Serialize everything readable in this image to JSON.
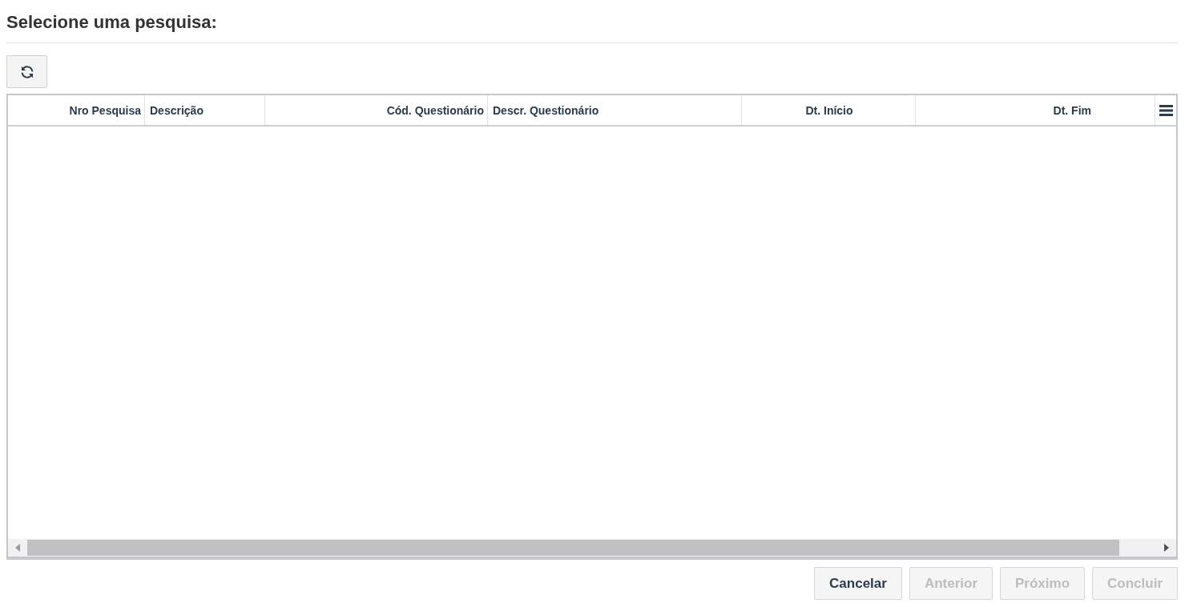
{
  "title": "Selecione uma pesquisa:",
  "toolbar": {
    "refresh_button": {
      "disabled": false
    }
  },
  "table": {
    "columns": [
      {
        "label": "Nro Pesquisa"
      },
      {
        "label": "Descrição"
      },
      {
        "label": "Cód. Questionário"
      },
      {
        "label": "Descr. Questionário"
      },
      {
        "label": "Dt. Início"
      },
      {
        "label": "Dt. Fim"
      }
    ]
  },
  "buttons": [
    {
      "label": "Cancelar",
      "disabled": false
    },
    {
      "label": "Anterior",
      "disabled": true
    },
    {
      "label": "Próximo",
      "disabled": true
    },
    {
      "label": "Concluir",
      "disabled": true
    }
  ]
}
